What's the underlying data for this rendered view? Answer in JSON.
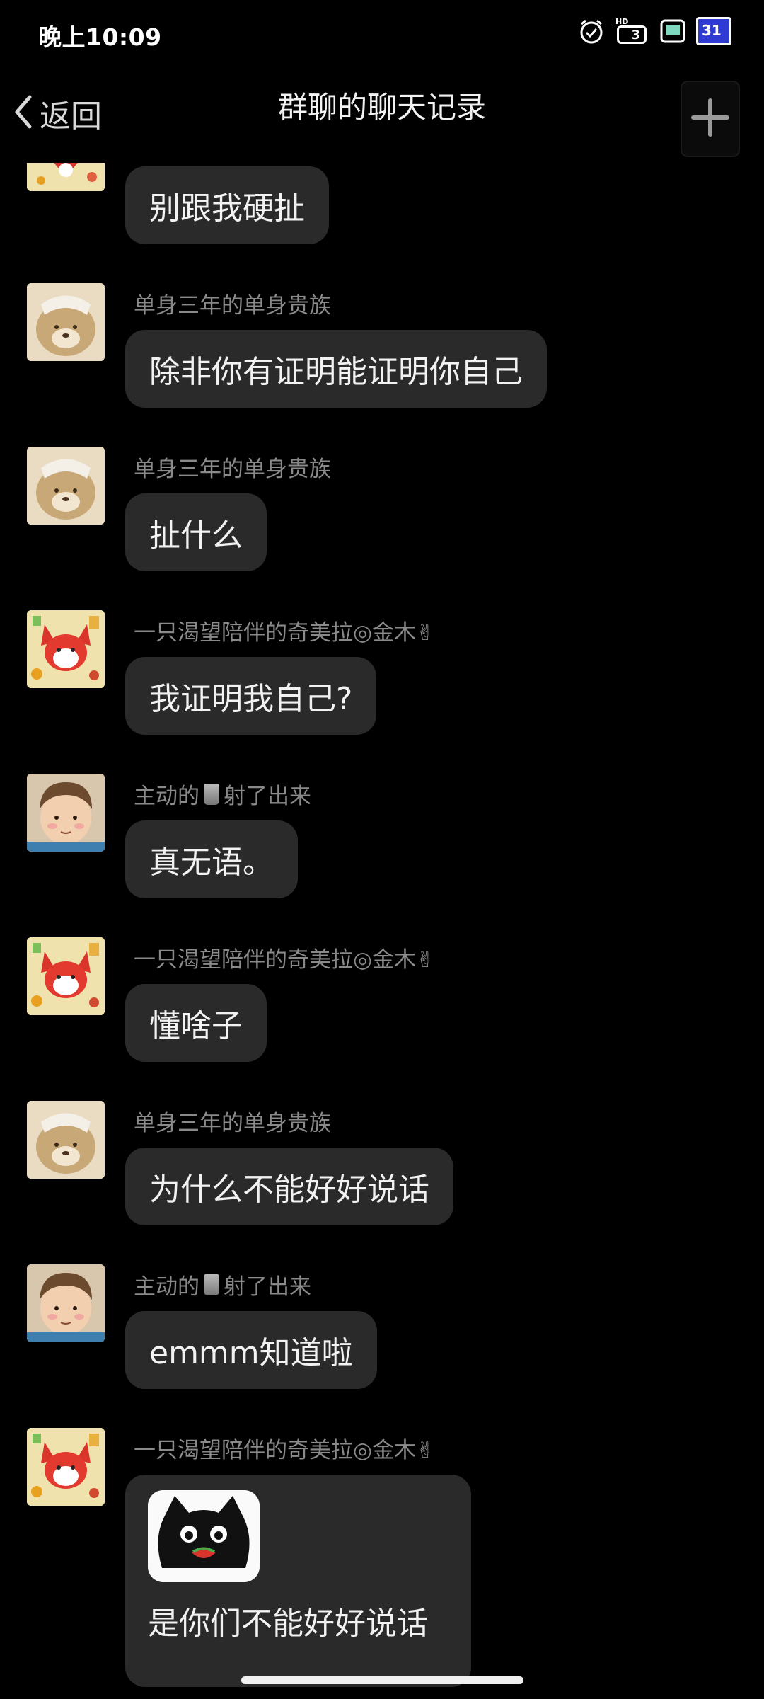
{
  "status_bar": {
    "time": "晚上10:09",
    "icons": [
      "alarm-icon",
      "hd-signal-icon",
      "battery-saver-icon",
      "calendar-icon"
    ],
    "hd_label": "HD",
    "signal_label": "3",
    "calendar_label": "31"
  },
  "header": {
    "back_label": "返回",
    "title": "群聊的聊天记录",
    "plus_icon": "plus-icon"
  },
  "messages": [
    {
      "sender": "",
      "avatar": "fox-avatar",
      "text": "别跟我硬扯"
    },
    {
      "sender": "单身三年的单身贵族",
      "avatar": "bear-avatar",
      "text": "除非你有证明能证明你自己"
    },
    {
      "sender": "单身三年的单身贵族",
      "avatar": "bear-avatar",
      "text": "扯什么"
    },
    {
      "sender": "一只渴望陪伴的奇美拉◎金木✌",
      "avatar": "fox-avatar",
      "text": "我证明我自己?"
    },
    {
      "sender_prefix": "主动的",
      "sender_suffix": "射了出来",
      "avatar": "boy-avatar",
      "text": "真无语。"
    },
    {
      "sender": "一只渴望陪伴的奇美拉◎金木✌",
      "avatar": "fox-avatar",
      "text": "懂啥子"
    },
    {
      "sender": "单身三年的单身贵族",
      "avatar": "bear-avatar",
      "text": "为什么不能好好说话"
    },
    {
      "sender_prefix": "主动的",
      "sender_suffix": "射了出来",
      "avatar": "boy-avatar",
      "text": "emmm知道啦"
    },
    {
      "sender": "一只渴望陪伴的奇美拉◎金木✌",
      "avatar": "fox-avatar",
      "sticker": "black-cat-sticker",
      "text": "是你们不能好好说话"
    }
  ]
}
